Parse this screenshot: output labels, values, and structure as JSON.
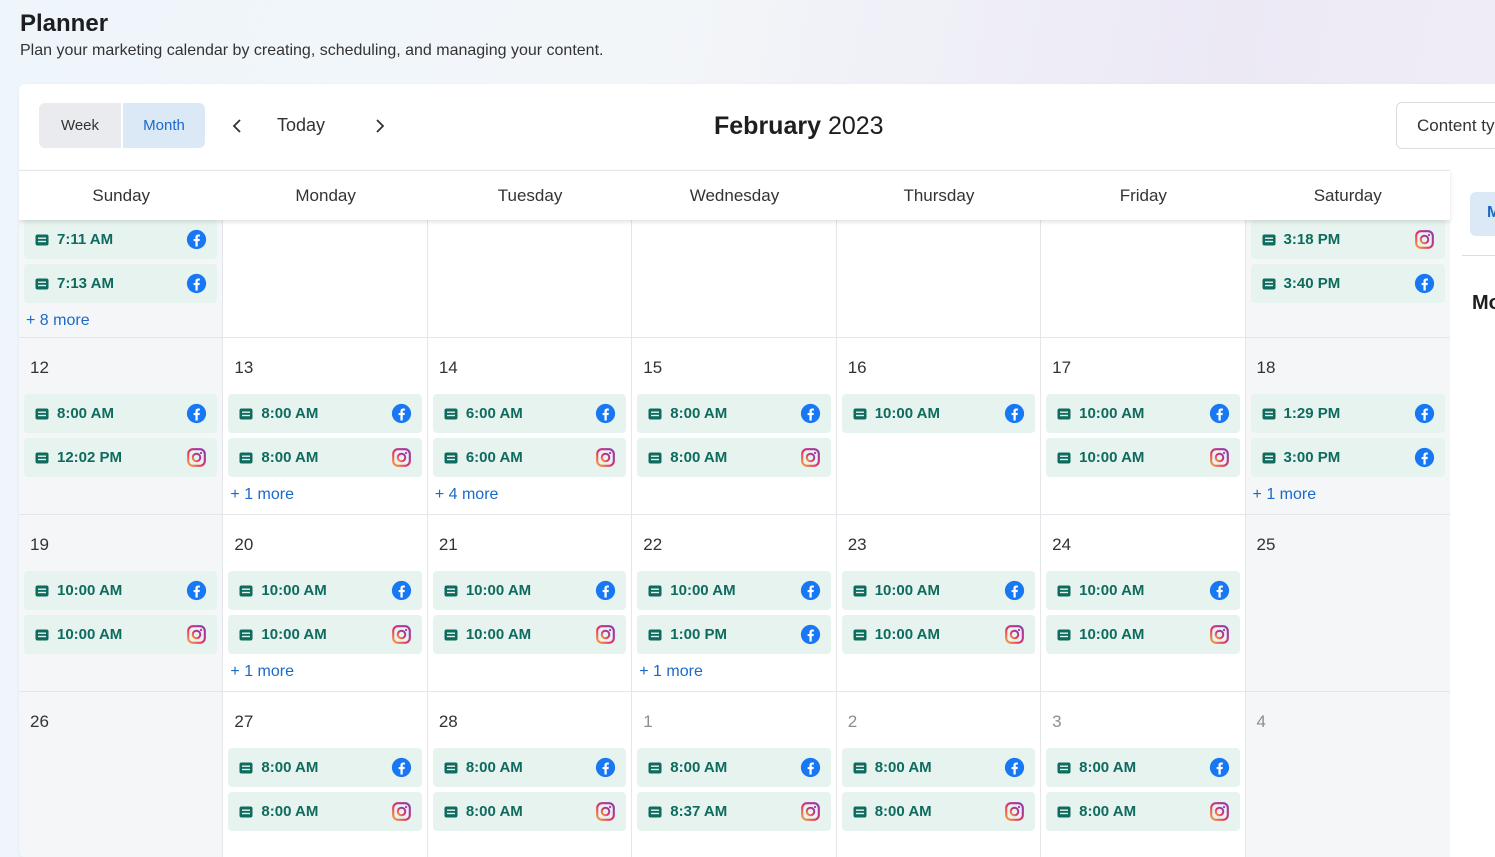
{
  "header": {
    "title": "Planner",
    "subtitle": "Plan your marketing calendar by creating, scheduling, and managing your content."
  },
  "toolbar": {
    "views": [
      "Week",
      "Month"
    ],
    "active_view": "Month",
    "prev_icon": "chevron-left-icon",
    "today_label": "Today",
    "next_icon": "chevron-right-icon",
    "month_name": "February",
    "year": "2023",
    "content_type_label": "Content ty"
  },
  "weekdays": [
    "Sunday",
    "Monday",
    "Tuesday",
    "Wednesday",
    "Thursday",
    "Friday",
    "Saturday"
  ],
  "weeks": [
    {
      "partial": true,
      "days": [
        {
          "day": "",
          "weekend": true,
          "muted": false,
          "events": [
            {
              "time": "7:11 AM",
              "network": "facebook"
            },
            {
              "time": "7:13 AM",
              "network": "facebook"
            }
          ],
          "more": "+ 8 more"
        },
        {
          "day": "",
          "weekend": false,
          "muted": false,
          "events": [],
          "more": ""
        },
        {
          "day": "",
          "weekend": false,
          "muted": false,
          "events": [],
          "more": ""
        },
        {
          "day": "",
          "weekend": false,
          "muted": false,
          "events": [],
          "more": ""
        },
        {
          "day": "",
          "weekend": false,
          "muted": false,
          "events": [],
          "more": ""
        },
        {
          "day": "",
          "weekend": false,
          "muted": false,
          "events": [],
          "more": ""
        },
        {
          "day": "",
          "weekend": true,
          "muted": false,
          "events": [
            {
              "time": "3:18 PM",
              "network": "instagram"
            },
            {
              "time": "3:40 PM",
              "network": "facebook"
            }
          ],
          "more": ""
        }
      ]
    },
    {
      "partial": false,
      "days": [
        {
          "day": "12",
          "weekend": true,
          "muted": false,
          "events": [
            {
              "time": "8:00 AM",
              "network": "facebook"
            },
            {
              "time": "12:02 PM",
              "network": "instagram"
            }
          ],
          "more": ""
        },
        {
          "day": "13",
          "weekend": false,
          "muted": false,
          "events": [
            {
              "time": "8:00 AM",
              "network": "facebook"
            },
            {
              "time": "8:00 AM",
              "network": "instagram"
            }
          ],
          "more": "+ 1 more"
        },
        {
          "day": "14",
          "weekend": false,
          "muted": false,
          "events": [
            {
              "time": "6:00 AM",
              "network": "facebook"
            },
            {
              "time": "6:00 AM",
              "network": "instagram"
            }
          ],
          "more": "+ 4 more"
        },
        {
          "day": "15",
          "weekend": false,
          "muted": false,
          "events": [
            {
              "time": "8:00 AM",
              "network": "facebook"
            },
            {
              "time": "8:00 AM",
              "network": "instagram"
            }
          ],
          "more": ""
        },
        {
          "day": "16",
          "weekend": false,
          "muted": false,
          "events": [
            {
              "time": "10:00 AM",
              "network": "facebook"
            }
          ],
          "more": ""
        },
        {
          "day": "17",
          "weekend": false,
          "muted": false,
          "events": [
            {
              "time": "10:00 AM",
              "network": "facebook"
            },
            {
              "time": "10:00 AM",
              "network": "instagram"
            }
          ],
          "more": ""
        },
        {
          "day": "18",
          "weekend": true,
          "muted": false,
          "events": [
            {
              "time": "1:29 PM",
              "network": "facebook"
            },
            {
              "time": "3:00 PM",
              "network": "facebook"
            }
          ],
          "more": "+ 1 more"
        }
      ]
    },
    {
      "partial": false,
      "days": [
        {
          "day": "19",
          "weekend": true,
          "muted": false,
          "events": [
            {
              "time": "10:00 AM",
              "network": "facebook"
            },
            {
              "time": "10:00 AM",
              "network": "instagram"
            }
          ],
          "more": ""
        },
        {
          "day": "20",
          "weekend": false,
          "muted": false,
          "events": [
            {
              "time": "10:00 AM",
              "network": "facebook"
            },
            {
              "time": "10:00 AM",
              "network": "instagram"
            }
          ],
          "more": "+ 1 more"
        },
        {
          "day": "21",
          "weekend": false,
          "muted": false,
          "events": [
            {
              "time": "10:00 AM",
              "network": "facebook"
            },
            {
              "time": "10:00 AM",
              "network": "instagram"
            }
          ],
          "more": ""
        },
        {
          "day": "22",
          "weekend": false,
          "muted": false,
          "events": [
            {
              "time": "10:00 AM",
              "network": "facebook"
            },
            {
              "time": "1:00 PM",
              "network": "facebook"
            }
          ],
          "more": "+ 1 more"
        },
        {
          "day": "23",
          "weekend": false,
          "muted": false,
          "events": [
            {
              "time": "10:00 AM",
              "network": "facebook"
            },
            {
              "time": "10:00 AM",
              "network": "instagram"
            }
          ],
          "more": ""
        },
        {
          "day": "24",
          "weekend": false,
          "muted": false,
          "events": [
            {
              "time": "10:00 AM",
              "network": "facebook"
            },
            {
              "time": "10:00 AM",
              "network": "instagram"
            }
          ],
          "more": ""
        },
        {
          "day": "25",
          "weekend": true,
          "muted": false,
          "events": [],
          "more": ""
        }
      ]
    },
    {
      "partial": false,
      "days": [
        {
          "day": "26",
          "weekend": true,
          "muted": false,
          "events": [],
          "more": ""
        },
        {
          "day": "27",
          "weekend": false,
          "muted": false,
          "events": [
            {
              "time": "8:00 AM",
              "network": "facebook"
            },
            {
              "time": "8:00 AM",
              "network": "instagram"
            }
          ],
          "more": ""
        },
        {
          "day": "28",
          "weekend": false,
          "muted": false,
          "events": [
            {
              "time": "8:00 AM",
              "network": "facebook"
            },
            {
              "time": "8:00 AM",
              "network": "instagram"
            }
          ],
          "more": ""
        },
        {
          "day": "1",
          "weekend": false,
          "muted": true,
          "events": [
            {
              "time": "8:00 AM",
              "network": "facebook"
            },
            {
              "time": "8:37 AM",
              "network": "instagram"
            }
          ],
          "more": ""
        },
        {
          "day": "2",
          "weekend": false,
          "muted": true,
          "events": [
            {
              "time": "8:00 AM",
              "network": "facebook"
            },
            {
              "time": "8:00 AM",
              "network": "instagram"
            }
          ],
          "more": ""
        },
        {
          "day": "3",
          "weekend": false,
          "muted": true,
          "events": [
            {
              "time": "8:00 AM",
              "network": "facebook"
            },
            {
              "time": "8:00 AM",
              "network": "instagram"
            }
          ],
          "more": ""
        },
        {
          "day": "4",
          "weekend": true,
          "muted": true,
          "events": [],
          "more": ""
        }
      ]
    }
  ],
  "side_panel": {
    "button_letter": "M",
    "heading": "Mo"
  },
  "colors": {
    "accent": "#1b6ac9",
    "event_bg": "#e6f3ef",
    "event_text": "#0e6b5e",
    "facebook": "#1877f2"
  }
}
